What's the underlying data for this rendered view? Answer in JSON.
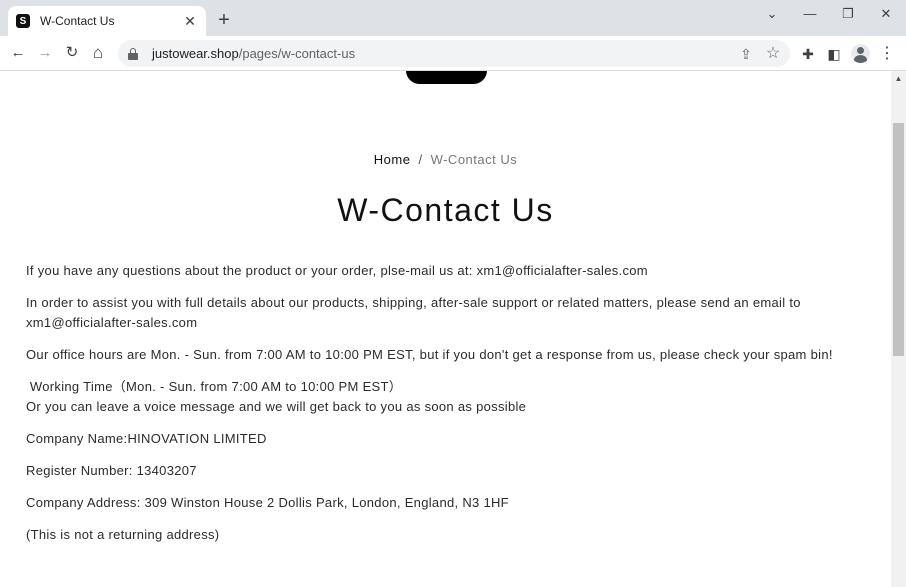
{
  "tab": {
    "favicon": "S",
    "title": "W-Contact Us",
    "close": "✕"
  },
  "newtab": "+",
  "window": {
    "minimize": "—",
    "restore": "❐",
    "close": "✕",
    "tab_search": "⌄"
  },
  "toolbar": {
    "back": "←",
    "forward": "→",
    "reload": "↻",
    "home": "⌂",
    "url_domain": "justowear.shop",
    "url_path": "/pages/w-contact-us",
    "share_icon": "⇪",
    "star_icon": "☆",
    "extensions_icon": "✚",
    "sidepanel_icon": "◧",
    "menu_icon": "⋮"
  },
  "breadcrumb": {
    "home": "Home",
    "separator": "/",
    "current": "W-Contact Us"
  },
  "page_title": "W-Contact Us",
  "content": {
    "p1": "If you have any questions about the product or your order, plse-mail us at: xm1@officialafter-sales.com",
    "p2": "In order to assist you with full details about our products, shipping, after-sale support or related matters, please send an email to xm1@officialafter-sales.com",
    "p3": "Our office hours are Mon. - Sun. from 7:00 AM to 10:00 PM EST, but if you don't get a response from us, please check your spam bin!",
    "p4_line1": " Working Time（Mon. - Sun. from 7:00 AM to 10:00 PM EST）",
    "p4_line2": "Or you can leave a voice message and we will get back to you as soon as possible",
    "p5": "Company Name:HINOVATION LIMITED",
    "p6": "Register Number: 13403207",
    "p7": "Company Address: 309 Winston House 2 Dollis Park, London, England, N3 1HF",
    "p8": "(This is not a returning address)"
  },
  "scrollbar": {
    "up_arrow": "▲"
  }
}
